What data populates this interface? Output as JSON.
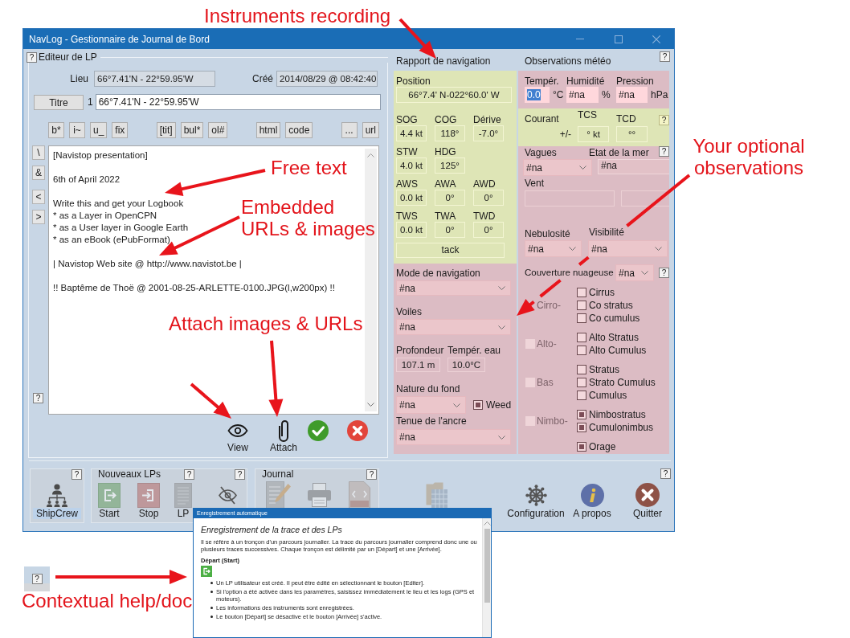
{
  "window": {
    "title": "NavLog - Gestionnaire de Journal de Bord"
  },
  "editor": {
    "help": "?",
    "title": "Editeur de LP",
    "place_label": "Lieu",
    "place": "66°7.41'N - 22°59.95'W",
    "created_label": "Créé",
    "created": "2014/08/29 @ 08:42:40",
    "title_button": "Titre",
    "title_number": "1",
    "title_value": "66°7.41'N - 22°59.95'W",
    "format_groups": [
      [
        "b*",
        "i~",
        "u_",
        "fix"
      ],
      [
        "[tit]",
        "bul*",
        "ol#"
      ],
      [
        "html",
        "code"
      ],
      [
        "...",
        "url"
      ]
    ],
    "side_buttons": [
      [
        "\\",
        "&"
      ],
      [
        "<",
        ">"
      ]
    ],
    "side_help": "?",
    "text_blocks": [
      [
        "[Navistop presentation]"
      ],
      [
        "6th of April 2022"
      ],
      [
        "Write this and get your Logbook",
        "* as a Layer in OpenCPN",
        "* as a User layer in Google Earth",
        "* as an eBook (ePubFormat)"
      ],
      [
        "| Navistop Web site @ http://www.navistot.be |"
      ],
      [
        "!! Baptême de Thoë @ 2001-08-25-ARLETTE-0100.JPG(l,w200px) !!"
      ]
    ],
    "actions": [
      {
        "kind": "view",
        "label": "View"
      },
      {
        "kind": "attach",
        "label": "Attach"
      },
      {
        "kind": "ok"
      },
      {
        "kind": "cancel"
      }
    ]
  },
  "navigation": {
    "title": "Rapport de navigation",
    "position_label": "Position",
    "position": "66°7.4' N-022°60.0' W",
    "readings": [
      [
        {
          "label": "SOG",
          "value": "4.4 kt"
        },
        {
          "label": "COG",
          "value": "118°"
        },
        {
          "label": "Dérive",
          "value": "-7.0°"
        }
      ],
      [
        {
          "label": "STW",
          "value": "4.0 kt"
        },
        {
          "label": "HDG",
          "value": "125°"
        }
      ],
      [
        {
          "label": "AWS",
          "value": "0.0 kt"
        },
        {
          "label": "AWA",
          "value": "0°"
        },
        {
          "label": "AWD",
          "value": "0°"
        }
      ],
      [
        {
          "label": "TWS",
          "value": "0.0 kt"
        },
        {
          "label": "TWA",
          "value": "0°"
        },
        {
          "label": "TWD",
          "value": "0°"
        }
      ]
    ],
    "tack": "tack",
    "mode": {
      "label": "Mode de navigation",
      "value": "#na"
    },
    "sails": {
      "label": "Voiles",
      "value": "#na"
    },
    "depth": {
      "label": "Profondeur",
      "value": "107.1 m"
    },
    "water_temperature": {
      "label": "Tempér. eau",
      "value": "10.0°C"
    },
    "bottom": {
      "label": "Nature du fond",
      "value": "#na"
    },
    "weed": {
      "label": "Weed",
      "checked": true
    },
    "anchor": {
      "label": "Tenue de l'ancre",
      "value": "#na"
    }
  },
  "weather": {
    "title": "Observations météo",
    "help": "?",
    "measures": [
      {
        "label": "Tempér.",
        "value": "0.0",
        "selected": true,
        "unit": "°C"
      },
      {
        "label": "Humidité",
        "value": "#na",
        "selected": false,
        "unit": "%"
      },
      {
        "label": "Pression",
        "value": "#na",
        "selected": false,
        "unit": "hPa"
      }
    ],
    "current": {
      "label": "Courant",
      "sign": "+/-",
      "speed_label": "TCS",
      "speed": "° kt",
      "direction_label": "TCD",
      "direction": "°°",
      "help": "?"
    },
    "sea": {
      "help": "?",
      "waves": {
        "label": "Vagues",
        "value": "#na"
      },
      "state": {
        "label": "Etat de la mer",
        "value": "#na"
      },
      "wind_label": "Vent"
    },
    "nebulosity": {
      "label": "Nebulosité",
      "value": "#na"
    },
    "visibility": {
      "label": "Visibilité",
      "value": "#na"
    },
    "cloud_cover": {
      "label": "Couverture nuageuse",
      "value": "#na",
      "help": "?",
      "groups": [
        {
          "label": "Cirro-",
          "disabled": true,
          "types": [
            {
              "label": "Cirrus",
              "checked": false
            },
            {
              "label": "Co stratus",
              "checked": false
            },
            {
              "label": "Co cumulus",
              "checked": false
            }
          ]
        },
        {
          "label": "Alto-",
          "disabled": true,
          "checked": false,
          "types": [
            {
              "label": "Alto Stratus",
              "checked": false
            },
            {
              "label": "Alto Cumulus",
              "checked": false
            }
          ]
        },
        {
          "label": "Bas",
          "disabled": true,
          "checked": false,
          "types": [
            {
              "label": "Stratus",
              "checked": false
            },
            {
              "label": "Strato Cumulus",
              "checked": false
            },
            {
              "label": "Cumulus",
              "checked": false
            }
          ]
        },
        {
          "label": "Nimbo-",
          "disabled": true,
          "checked": false,
          "types": [
            {
              "label": "Nimbostratus",
              "checked": true
            },
            {
              "label": "Cumulonimbus",
              "checked": true
            }
          ]
        },
        {
          "types": [
            {
              "label": "Orage",
              "checked": true
            }
          ]
        }
      ]
    }
  },
  "toolbar": {
    "groups": [
      {
        "help": [
          "?"
        ],
        "items": [
          {
            "kind": "crew",
            "label": "ShipCrew",
            "focused": true
          }
        ]
      },
      {
        "title": "Nouveaux LPs",
        "help": [
          "?",
          "?"
        ],
        "items": [
          {
            "kind": "start",
            "label": "Start",
            "disabled": true
          },
          {
            "kind": "stop",
            "label": "Stop",
            "disabled": true
          },
          {
            "kind": "lp",
            "label": "LP",
            "disabled": true
          },
          {
            "kind": "hide",
            "disabled": false
          }
        ]
      },
      {
        "title": "Journal",
        "help": [
          "?"
        ],
        "items": [
          {
            "kind": "edit",
            "disabled": true
          },
          {
            "kind": "print",
            "disabled": true
          },
          {
            "kind": "html",
            "disabled": true
          }
        ]
      }
    ],
    "tools": [
      {
        "kind": "map",
        "disabled": true
      },
      {
        "kind": "config",
        "label": "Configuration",
        "disabled": false
      },
      {
        "kind": "about",
        "label": "A propos",
        "disabled": false
      },
      {
        "kind": "quit",
        "label": "Quitter",
        "disabled": false
      }
    ],
    "help": "?"
  },
  "help_window": {
    "title": "Enregistrement automatique",
    "heading": "Enregistrement de la trace et des LPs",
    "intro": "Il se réfère à un tronçon d'un parcours journalier. La trace du parcours journalier comprend donc une ou plusieurs traces successives. Chaque tronçon est délimité par un [Départ] et une [Arrivée].",
    "section": "Départ (Start)",
    "bullets": [
      "Un LP utilisateur est créé. Il peut être édité en sélectionnant le bouton [Editer].",
      "Si l'option a été activée dans les paramètres, saisissez immédiatement le lieu et les logs (GPS et moteurs).",
      "Les informations des instruments sont enregistrées.",
      "Le bouton [Départ] se désactive et le bouton [Arrivée] s'active."
    ]
  },
  "help_sample": {
    "label": "?"
  },
  "annotations": [
    {
      "text": "Instruments recording"
    },
    {
      "text": "Free text"
    },
    {
      "text": "Embedded URLs & images"
    },
    {
      "text": "Attach images & URLs"
    },
    {
      "text": "Your optional observations"
    },
    {
      "text": "Contextual help/doc"
    }
  ]
}
